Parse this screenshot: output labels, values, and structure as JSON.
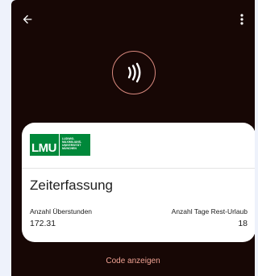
{
  "topbar": {
    "back_icon": "arrow-left-icon",
    "more_icon": "more-vert-icon"
  },
  "nfc": {
    "icon": "contactless-icon",
    "ring_color": "#d9897e"
  },
  "card": {
    "logo": {
      "main": "LMU",
      "sub_lines": [
        "LUDWIG-",
        "MAXIMILIANS-",
        "UNIVERSITÄT",
        "MÜNCHEN"
      ],
      "color": "#00883a"
    },
    "title": "Zeiterfassung",
    "fields": {
      "left_label": "Anzahl Überstunden",
      "left_value": "172.31",
      "right_label": "Anzahl Tage Rest-Urlaub",
      "right_value": "18"
    }
  },
  "code_button_label": "Code anzeigen",
  "colors": {
    "background": "#170705",
    "accent": "#f2a394"
  }
}
